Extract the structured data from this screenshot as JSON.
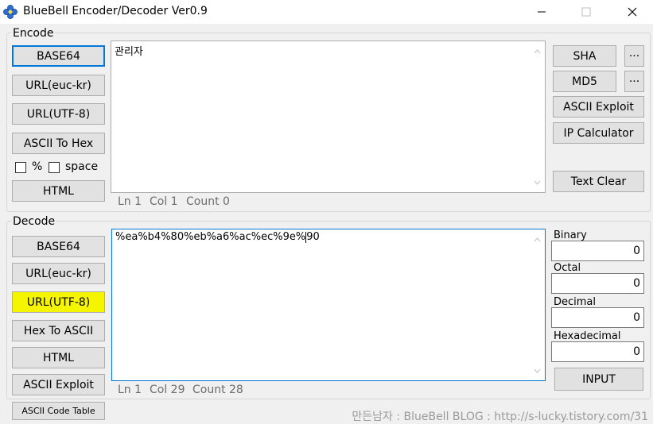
{
  "window": {
    "title": "BlueBell Encoder/Decoder  Ver0.9",
    "icon": "flower-icon",
    "controls": [
      "minimize",
      "maximize",
      "close"
    ]
  },
  "encode": {
    "group_label": "Encode",
    "buttons": {
      "base64": "BASE64",
      "url_euckr": "URL(euc-kr)",
      "url_utf8": "URL(UTF-8)",
      "ascii_to_hex": "ASCII To Hex",
      "html": "HTML"
    },
    "checkboxes": {
      "percent": {
        "label": "%",
        "checked": false
      },
      "space": {
        "label": "space",
        "checked": false
      }
    },
    "input_text": "관리자",
    "status": {
      "ln": "Ln 1",
      "col": "Col 1",
      "count": "Count 0"
    },
    "right_buttons": {
      "sha": "SHA",
      "sha_more": "···",
      "md5": "MD5",
      "md5_more": "···",
      "ascii_exploit": "ASCII Exploit",
      "ip_calculator": "IP Calculator",
      "text_clear": "Text Clear"
    }
  },
  "decode": {
    "group_label": "Decode",
    "buttons": {
      "base64": "BASE64",
      "url_euckr": "URL(euc-kr)",
      "url_utf8": "URL(UTF-8)",
      "hex_to_ascii": "Hex To ASCII",
      "html": "HTML",
      "ascii_exploit": "ASCII Exploit"
    },
    "input_text_before_caret": "%ea%b4%80%eb%a6%ac%ec%9e%",
    "input_text_after_caret": "90",
    "status": {
      "ln": "Ln 1",
      "col": "Col 29",
      "count": "Count 28"
    },
    "converter": {
      "binary_label": "Binary",
      "binary_value": "0",
      "octal_label": "Octal",
      "octal_value": "0",
      "decimal_label": "Decimal",
      "decimal_value": "0",
      "hex_label": "Hexadecimal",
      "hex_value": "0",
      "input_button": "INPUT"
    }
  },
  "footer": {
    "ascii_code_table": "ASCII Code Table",
    "credit": "만든남자 : BlueBell   BLOG : http://s-lucky.tistory.com/31"
  },
  "colors": {
    "focus_border": "#0078d7",
    "highlight": "#f5f500"
  }
}
